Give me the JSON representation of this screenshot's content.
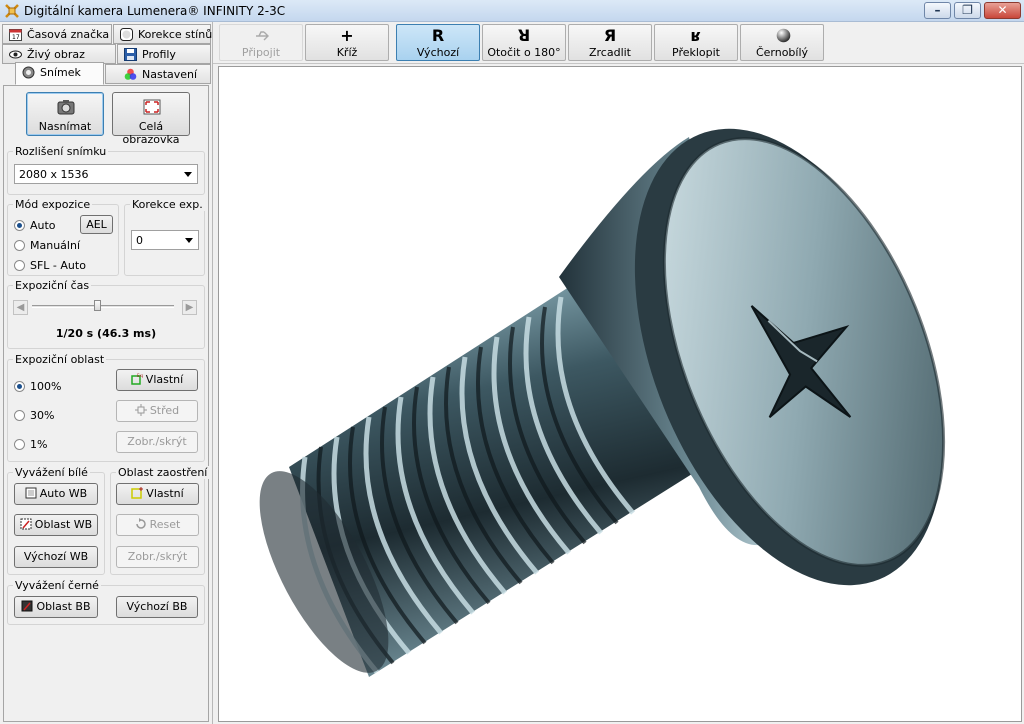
{
  "window": {
    "title": "Digitální kamera Lumenera® INFINITY 2-3C",
    "min_symbol": "–",
    "max_symbol": "❐",
    "close_symbol": "✕"
  },
  "tabs": {
    "row1": [
      "Časová značka",
      "Korekce stínů"
    ],
    "row2": [
      "Živý obraz",
      "Profily"
    ],
    "row3": [
      "Snímek",
      "Nastavení"
    ],
    "active": "Snímek"
  },
  "capture": {
    "capture_label": "Nasnímat",
    "fullscreen_label": "Celá obrazovka"
  },
  "resolution": {
    "title": "Rozlišení snímku",
    "value": "2080 x 1536"
  },
  "exposure_mode": {
    "title": "Mód expozice",
    "options": [
      "Auto",
      "Manuální",
      "SFL - Auto"
    ],
    "selected": "Auto",
    "ael_label": "AEL"
  },
  "exposure_correction": {
    "title": "Korekce exp.",
    "value": "0"
  },
  "exposure_time": {
    "title": "Expoziční čas",
    "value_text": "1/20 s  (46.3 ms)",
    "slider_fraction": 0.46
  },
  "exposure_area": {
    "title": "Expoziční oblast",
    "options": [
      "100%",
      "30%",
      "1%"
    ],
    "selected": "100%",
    "custom_label": "Vlastní",
    "center_label": "Střed",
    "showhide_label": "Zobr./skrýt"
  },
  "white_balance": {
    "title": "Vyvážení bílé",
    "auto_label": "Auto WB",
    "area_label": "Oblast WB",
    "default_label": "Výchozí WB"
  },
  "focus_area": {
    "title": "Oblast zaostření",
    "custom_label": "Vlastní",
    "reset_label": "Reset",
    "showhide_label": "Zobr./skrýt"
  },
  "black_balance": {
    "title": "Vyvážení černé",
    "area_label": "Oblast BB",
    "default_label": "Výchozí BB"
  },
  "toolbar": {
    "connect": "Připojit",
    "cross": "Kříž",
    "default": "Výchozí",
    "rotate": "Otočit o 180°",
    "mirror": "Zrcadlit",
    "flip": "Překlopit",
    "grayscale": "Černobílý",
    "cross_symbol": "+",
    "default_symbol": "R",
    "rotate_symbol": "ꓤ",
    "mirror_symbol": "Я",
    "flip_symbol": "ʁ"
  },
  "colors": {
    "active_accent": "#3c7fb1",
    "titlebar": "#c4d7ee",
    "close_button": "#c9473a"
  }
}
